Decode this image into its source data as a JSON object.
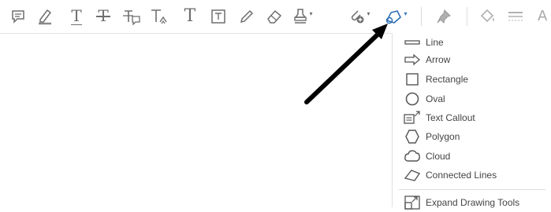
{
  "toolbar": {
    "icons": [
      "sticky-note-icon",
      "highlight-icon",
      "underline-text-icon",
      "strikethrough-text-icon",
      "replace-text-icon",
      "insert-text-icon",
      "add-text-icon",
      "text-box-icon",
      "pencil-icon",
      "eraser-icon",
      "stamp-icon",
      "attach-file-icon",
      "drawing-tools-icon",
      "pin-icon",
      "fill-color-icon",
      "line-style-icon",
      "text-properties-icon"
    ],
    "text_glyph": "T",
    "font_glyph": "A"
  },
  "drawing_menu": {
    "items": [
      {
        "label": "Line",
        "icon": "line-icon"
      },
      {
        "label": "Arrow",
        "icon": "arrow-icon"
      },
      {
        "label": "Rectangle",
        "icon": "rectangle-icon"
      },
      {
        "label": "Oval",
        "icon": "oval-icon"
      },
      {
        "label": "Text Callout",
        "icon": "text-callout-icon"
      },
      {
        "label": "Polygon",
        "icon": "polygon-icon"
      },
      {
        "label": "Cloud",
        "icon": "cloud-icon"
      },
      {
        "label": "Connected Lines",
        "icon": "connected-lines-icon"
      }
    ],
    "expand_label": "Expand Drawing Tools",
    "expand_icon": "expand-drawing-tools-icon"
  },
  "colors": {
    "icon_gray": "#6e6e6e",
    "active_blue": "#2c6fb5",
    "annotation_arrow": "#000000"
  }
}
